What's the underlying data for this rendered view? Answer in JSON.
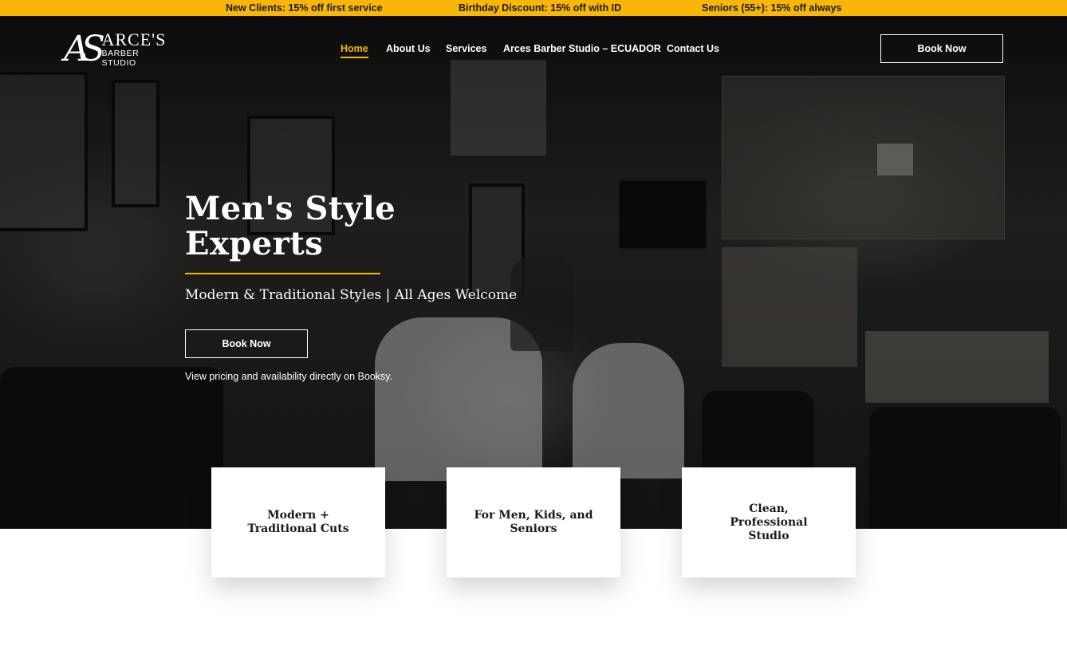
{
  "promo": [
    "New Clients: 15% off first service",
    "Birthday Discount: 15% off with ID",
    "Seniors (55+): 15% off always"
  ],
  "brand": {
    "mark": "AS",
    "name": "ARCE'S",
    "subtitle": "BARBER STUDIO"
  },
  "nav": {
    "items": [
      "Home",
      "About Us",
      "Services",
      "Arces Barber Studio – ECUADOR",
      "Contact Us"
    ],
    "active": "Home",
    "book_label": "Book Now"
  },
  "hero": {
    "title_line1": "Men's Style",
    "title_line2": "Experts",
    "subtitle": "Modern & Traditional Styles | All Ages Welcome",
    "button_label": "Book Now",
    "note": "View pricing and availability directly on Booksy."
  },
  "features": [
    "Modern + Traditional Cuts",
    "For Men, Kids, and Seniors",
    "Clean, Professional Studio"
  ],
  "colors": {
    "accent": "#f7b608",
    "hero_bg": "#1e1d1b",
    "text_light": "#ffffff",
    "text_dark": "#1a1a1a"
  }
}
